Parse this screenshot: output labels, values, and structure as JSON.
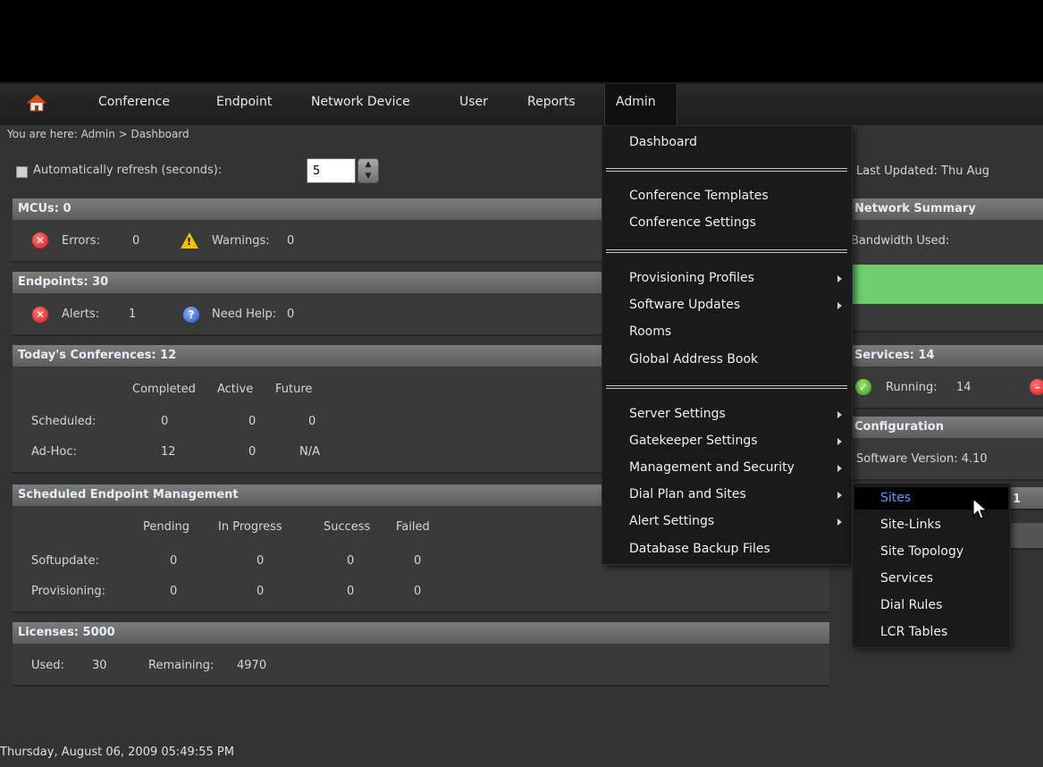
{
  "nav": {
    "home_icon": "home-icon",
    "items": [
      "Conference",
      "Endpoint",
      "Network Device",
      "User",
      "Reports",
      "Admin"
    ]
  },
  "breadcrumb": "You are here:  Admin  >  Dashboard",
  "refresh": {
    "label": "Automatically refresh (seconds):",
    "value": "5"
  },
  "mcus": {
    "title": "MCUs: 0",
    "errors_label": "Errors:",
    "errors": "0",
    "warnings_label": "Warnings:",
    "warnings": "0"
  },
  "endpoints": {
    "title": "Endpoints: 30",
    "alerts_label": "Alerts:",
    "alerts": "1",
    "help_label": "Need Help:",
    "help": "0"
  },
  "conferences": {
    "title": "Today's Conferences: 12",
    "columns": [
      "Completed",
      "Active",
      "Future"
    ],
    "rows": [
      {
        "label": "Scheduled:",
        "values": [
          "0",
          "0",
          "0"
        ]
      },
      {
        "label": "Ad-Hoc:",
        "values": [
          "12",
          "0",
          "N/A"
        ]
      }
    ]
  },
  "sem": {
    "title": "Scheduled Endpoint Management",
    "columns": [
      "Pending",
      "In Progress",
      "Success",
      "Failed"
    ],
    "rows": [
      {
        "label": "Softupdate:",
        "values": [
          "0",
          "0",
          "0",
          "0"
        ]
      },
      {
        "label": "Provisioning:",
        "values": [
          "0",
          "0",
          "0",
          "0"
        ]
      }
    ]
  },
  "licenses": {
    "title": "Licenses: 5000",
    "used_label": "Used:",
    "used": "30",
    "remaining_label": "Remaining:",
    "remaining": "4970"
  },
  "right": {
    "last_updated": "Last Updated:    Thu Aug",
    "network_title": "Network Summary",
    "bandwidth_label": "Bandwidth Used:",
    "services_title": "Services: 14",
    "running_label": "Running:",
    "running": "14",
    "config_title": "Configuration",
    "software_version": "Software Version:  4.10",
    "partial_value": "1"
  },
  "admin_menu": [
    "Dashboard",
    "Conference Templates",
    "Conference Settings",
    "Provisioning Profiles",
    "Software Updates",
    "Rooms",
    "Global Address Book",
    "Server Settings",
    "Gatekeeper Settings",
    "Management and Security",
    "Dial Plan and Sites",
    "Alert Settings",
    "Database Backup Files"
  ],
  "dial_plan_submenu": [
    "Sites",
    "Site-Links",
    "Site Topology",
    "Services",
    "Dial Rules",
    "LCR Tables"
  ],
  "footer": "Thursday, August 06, 2009 05:49:55 PM",
  "colors": {
    "bandwidth_bar": "#6fcf6f",
    "panel_header": "#6a6a6a",
    "menu_bg": "#1a1a1a"
  }
}
